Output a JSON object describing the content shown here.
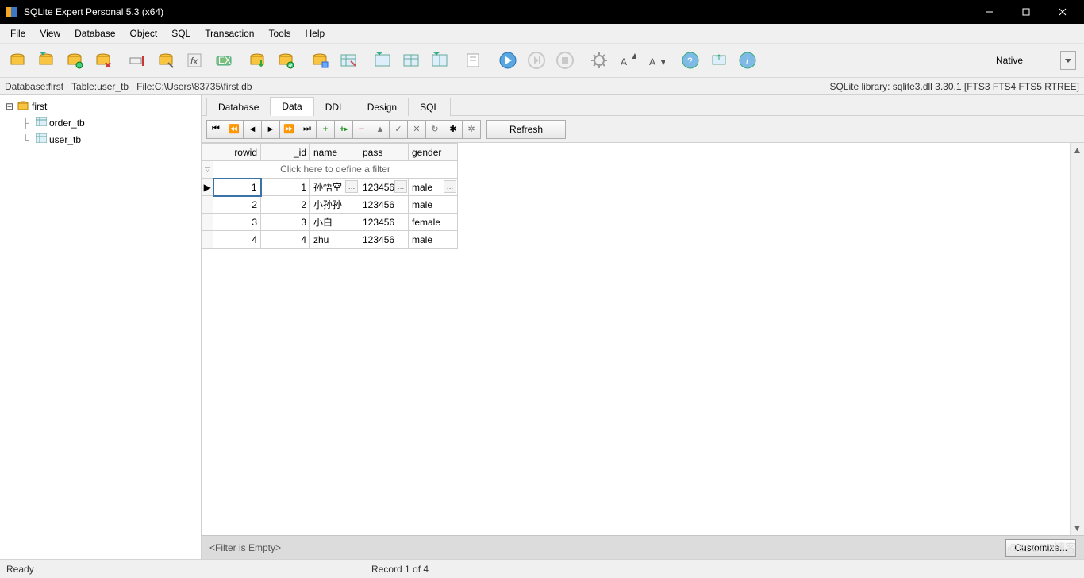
{
  "window": {
    "title": "SQLite Expert Personal 5.3 (x64)"
  },
  "menu": [
    "File",
    "View",
    "Database",
    "Object",
    "SQL",
    "Transaction",
    "Tools",
    "Help"
  ],
  "toolbar_mode": {
    "label": "Native"
  },
  "infobar": {
    "db_label": "Database: ",
    "db_name": "first",
    "table_label": "Table: ",
    "table_name": "user_tb",
    "file_label": "File: ",
    "file_path": "C:\\Users\\83735\\first.db",
    "lib": "SQLite library: sqlite3.dll 3.30.1 [FTS3 FTS4 FTS5 RTREE]"
  },
  "tree": {
    "db": "first",
    "tables": [
      "order_tb",
      "user_tb"
    ]
  },
  "tabs": [
    "Database",
    "Data",
    "DDL",
    "Design",
    "SQL"
  ],
  "active_tab": "Data",
  "grid_toolbar": {
    "refresh": "Refresh"
  },
  "grid": {
    "columns": [
      "rowid",
      "_id",
      "name",
      "pass",
      "gender"
    ],
    "filter_hint": "Click here to define a filter",
    "rows": [
      {
        "rowid": 1,
        "_id": 1,
        "name": "孙悟空",
        "pass": "123456",
        "gender": "male"
      },
      {
        "rowid": 2,
        "_id": 2,
        "name": "小孙孙",
        "pass": "123456",
        "gender": "male"
      },
      {
        "rowid": 3,
        "_id": 3,
        "name": "小白",
        "pass": "123456",
        "gender": "female"
      },
      {
        "rowid": 4,
        "_id": 4,
        "name": "zhu",
        "pass": "123456",
        "gender": "male"
      }
    ]
  },
  "filter_footer": {
    "text": "<Filter is Empty>",
    "customize": "Customize..."
  },
  "statusbar": {
    "ready": "Ready",
    "record": "Record 1 of 4"
  },
  "watermark": "@51CTO博客"
}
